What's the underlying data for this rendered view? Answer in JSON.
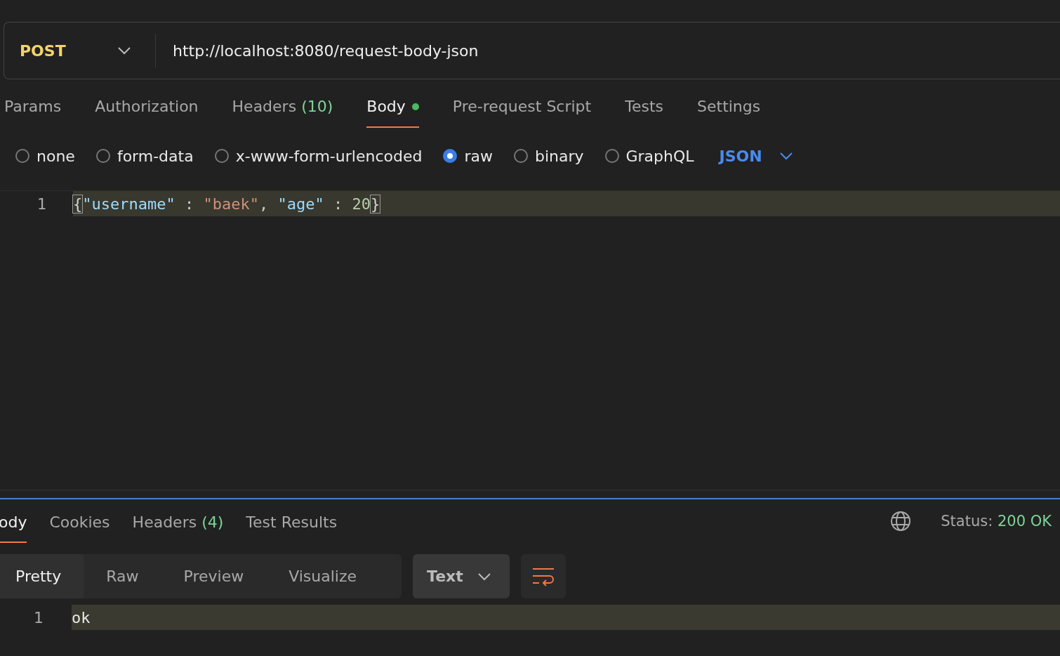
{
  "request": {
    "method": "POST",
    "url": "http://localhost:8080/request-body-json"
  },
  "request_tabs": [
    {
      "label": "Params",
      "selected": false,
      "has_content": false
    },
    {
      "label": "Authorization",
      "selected": false,
      "has_content": false
    },
    {
      "label": "Headers",
      "count": "(10)",
      "selected": false,
      "has_content": false
    },
    {
      "label": "Body",
      "selected": true,
      "has_content": true
    },
    {
      "label": "Pre-request Script",
      "selected": false,
      "has_content": false
    },
    {
      "label": "Tests",
      "selected": false,
      "has_content": false
    },
    {
      "label": "Settings",
      "selected": false,
      "has_content": false
    }
  ],
  "body_types": [
    {
      "label": "none",
      "selected": false
    },
    {
      "label": "form-data",
      "selected": false
    },
    {
      "label": "x-www-form-urlencoded",
      "selected": false
    },
    {
      "label": "raw",
      "selected": true
    },
    {
      "label": "binary",
      "selected": false
    },
    {
      "label": "GraphQL",
      "selected": false
    }
  ],
  "raw_format": "JSON",
  "editor": {
    "lines": [
      {
        "number": "1",
        "tokens": [
          {
            "kind": "bracket",
            "text": "{"
          },
          {
            "kind": "key",
            "text": "\"username\""
          },
          {
            "kind": "punct",
            "text": " : "
          },
          {
            "kind": "string",
            "text": "\"baek\""
          },
          {
            "kind": "punct",
            "text": ", "
          },
          {
            "kind": "key",
            "text": "\"age\""
          },
          {
            "kind": "punct",
            "text": " : "
          },
          {
            "kind": "number",
            "text": "20"
          },
          {
            "kind": "bracket",
            "text": "}"
          }
        ]
      }
    ]
  },
  "response": {
    "tabs": [
      {
        "label": "ody",
        "selected": true
      },
      {
        "label": "Cookies",
        "selected": false
      },
      {
        "label": "Headers",
        "count": "(4)",
        "selected": false
      },
      {
        "label": "Test Results",
        "selected": false
      }
    ],
    "status_label": "Status:",
    "status": "200 OK",
    "views": [
      {
        "label": "Pretty",
        "selected": true
      },
      {
        "label": "Raw",
        "selected": false
      },
      {
        "label": "Preview",
        "selected": false
      },
      {
        "label": "Visualize",
        "selected": false
      }
    ],
    "format": "Text",
    "lines": [
      {
        "number": "1",
        "text": "ok"
      }
    ]
  }
}
